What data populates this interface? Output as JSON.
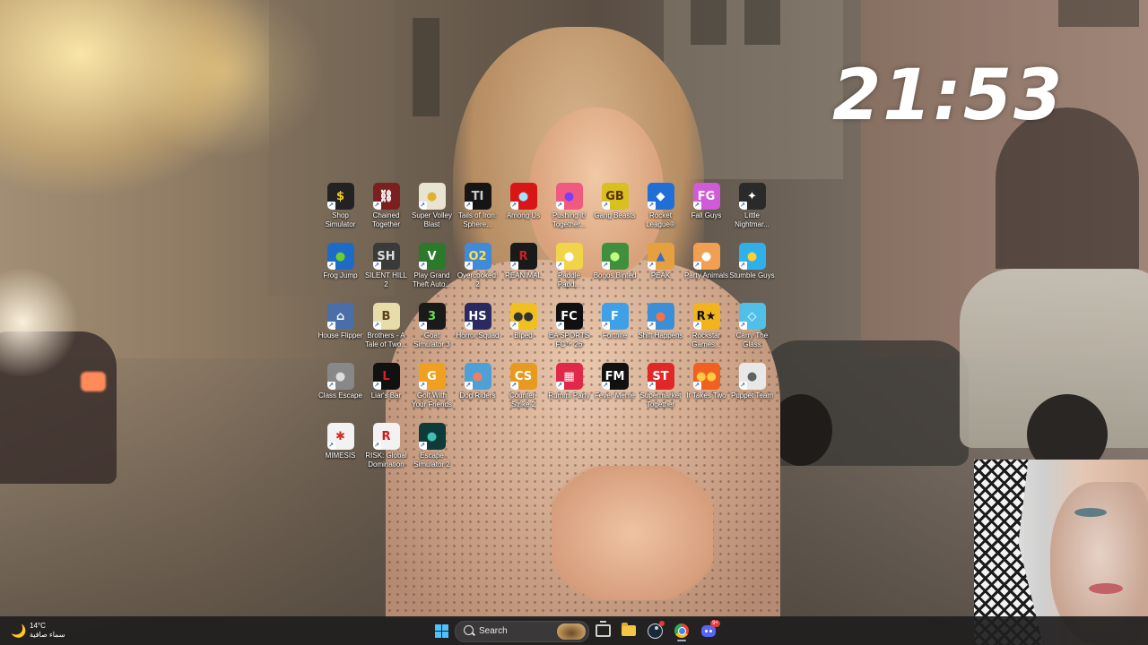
{
  "clock": {
    "time": "21:53"
  },
  "desktop_icons": [
    {
      "label": "Shop Simulator",
      "tile": "$",
      "bg": "#222222",
      "fg": "#f5d020"
    },
    {
      "label": "Chained Together",
      "tile": "⛓",
      "bg": "#7a2020",
      "fg": "#ffffff"
    },
    {
      "label": "Super Volley Blast",
      "tile": "●",
      "bg": "#e9e3d2",
      "fg": "#e0b030"
    },
    {
      "label": "Tails of Iron: Sphere...",
      "tile": "TI",
      "bg": "#151515",
      "fg": "#cccccc"
    },
    {
      "label": "Among Us",
      "tile": "●",
      "bg": "#d91616",
      "fg": "#9fe3ff"
    },
    {
      "label": "Pushing it! Together...",
      "tile": "●",
      "bg": "#f15a80",
      "fg": "#7c3cff"
    },
    {
      "label": "Gang Beasts",
      "tile": "GB",
      "bg": "#d8c020",
      "fg": "#5a3000"
    },
    {
      "label": "Rocket League®",
      "tile": "◆",
      "bg": "#1f6fd6",
      "fg": "#ffffff"
    },
    {
      "label": "Fall Guys",
      "tile": "FG",
      "bg": "#d05bd8",
      "fg": "#ffffff"
    },
    {
      "label": "Little Nightmar...",
      "tile": "✦",
      "bg": "#2a2a2a",
      "fg": "#ffffff"
    },
    {
      "label": "Frog Jump",
      "tile": "●",
      "bg": "#1e6ac9",
      "fg": "#6bd12a"
    },
    {
      "label": "SILENT HILL 2",
      "tile": "SH",
      "bg": "#3a3a3a",
      "fg": "#dddddd"
    },
    {
      "label": "Play Grand Theft Auto...",
      "tile": "V",
      "bg": "#2b7a2b",
      "fg": "#ffffff"
    },
    {
      "label": "Overcooked! 2",
      "tile": "O2",
      "bg": "#3f8ad9",
      "fg": "#ffe04a"
    },
    {
      "label": "REANIMAL",
      "tile": "R",
      "bg": "#1a1a1a",
      "fg": "#d02020"
    },
    {
      "label": "Paddle Padd...",
      "tile": "●",
      "bg": "#f2d44a",
      "fg": "#ffffff"
    },
    {
      "label": "Bogos Binted",
      "tile": "●",
      "bg": "#3f8f3f",
      "fg": "#c0ff80"
    },
    {
      "label": "PEAK",
      "tile": "▲",
      "bg": "#e6a040",
      "fg": "#3a6fbf"
    },
    {
      "label": "Party Animals",
      "tile": "●",
      "bg": "#f0a050",
      "fg": "#ffffff"
    },
    {
      "label": "Stumble Guys",
      "tile": "●",
      "bg": "#2fb0e8",
      "fg": "#ffcf30"
    },
    {
      "label": "House Flipper",
      "tile": "⌂",
      "bg": "#4a6fa8",
      "fg": "#ffffff"
    },
    {
      "label": "Brothers - A Tale of Two...",
      "tile": "B",
      "bg": "#e8dca8",
      "fg": "#5a4020"
    },
    {
      "label": "Goat Simulator 3",
      "tile": "3",
      "bg": "#1a1a1a",
      "fg": "#66e04a"
    },
    {
      "label": "Horror Squad",
      "tile": "HS",
      "bg": "#2a2a60",
      "fg": "#ffffff"
    },
    {
      "label": "Biped",
      "tile": "●●",
      "bg": "#f0c020",
      "fg": "#333333"
    },
    {
      "label": "EA SPORTS FC™ 26",
      "tile": "FC",
      "bg": "#101010",
      "fg": "#ffffff"
    },
    {
      "label": "Fortnite",
      "tile": "F",
      "bg": "#3fa0e8",
      "fg": "#ffffff"
    },
    {
      "label": "Shift Happens",
      "tile": "●",
      "bg": "#3a8fd8",
      "fg": "#ff7040"
    },
    {
      "label": "Rockstar Games...",
      "tile": "R★",
      "bg": "#f2b41e",
      "fg": "#111111"
    },
    {
      "label": "Carry The Glass",
      "tile": "◇",
      "bg": "#50c0e8",
      "fg": "#ffffff"
    },
    {
      "label": "Class Escape",
      "tile": "●",
      "bg": "#888888",
      "fg": "#dddddd"
    },
    {
      "label": "Liar's Bar",
      "tile": "L",
      "bg": "#111111",
      "fg": "#e02020"
    },
    {
      "label": "Golf With Your Friends",
      "tile": "G",
      "bg": "#f0a020",
      "fg": "#ffffff"
    },
    {
      "label": "Dog Riders",
      "tile": "●",
      "bg": "#50a0d8",
      "fg": "#f08060"
    },
    {
      "label": "Counter-Strike 2",
      "tile": "CS",
      "bg": "#e89a20",
      "fg": "#ffffff"
    },
    {
      "label": "Rummi Party",
      "tile": "▦",
      "bg": "#e02848",
      "fg": "#ffffff"
    },
    {
      "label": "Fever Meme",
      "tile": "FM",
      "bg": "#111111",
      "fg": "#ffffff"
    },
    {
      "label": "Supermarket Together",
      "tile": "ST",
      "bg": "#e02828",
      "fg": "#ffffff"
    },
    {
      "label": "It Takes Two",
      "tile": "●●",
      "bg": "#f06020",
      "fg": "#ffcc40"
    },
    {
      "label": "Puppet Team",
      "tile": "●",
      "bg": "#e8e8e8",
      "fg": "#606060"
    },
    {
      "label": "MIMESIS",
      "tile": "✱",
      "bg": "#f2f2f2",
      "fg": "#d03020"
    },
    {
      "label": "RISK: Global Domination",
      "tile": "R",
      "bg": "#f2f2f2",
      "fg": "#d01818"
    },
    {
      "label": "Escape Simulator 2",
      "tile": "●",
      "bg": "#0e3a3a",
      "fg": "#40c0b0"
    }
  ],
  "weather": {
    "temp": "14°C",
    "desc": "سماء صافية",
    "icon": "moon-icon"
  },
  "taskbar": {
    "search_label": "Search",
    "apps": [
      "start-icon",
      "search-icon",
      "task-view-icon",
      "file-explorer-icon",
      "steam-icon",
      "chrome-icon",
      "discord-icon"
    ],
    "discord_badge": "9+"
  },
  "colors": {
    "accent": "#4cc2ff",
    "taskbar_bg": "#201e1e"
  }
}
